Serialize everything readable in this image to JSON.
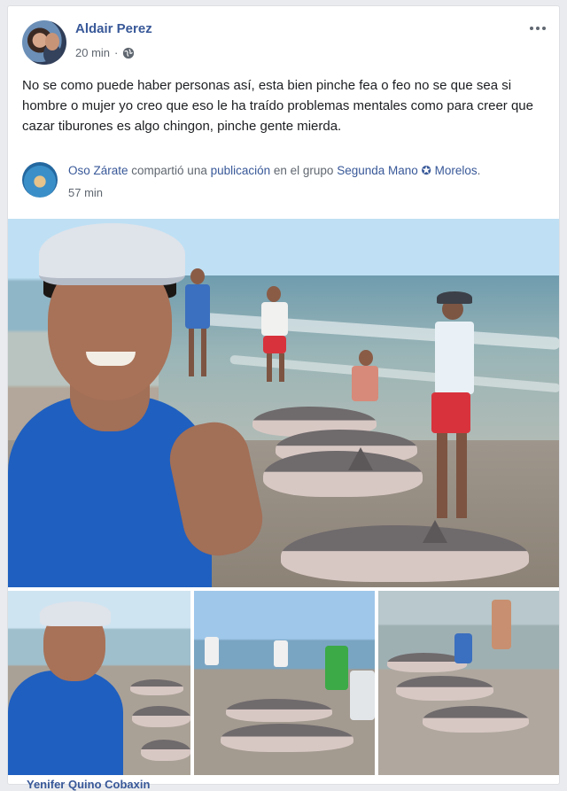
{
  "post": {
    "author": "Aldair Perez",
    "time": "20 min",
    "text": "No se como puede haber personas así, esta bien pinche fea o feo no se que sea si hombre o mujer yo creo que eso le ha traído problemas mentales como para creer que cazar tiburones es algo chingon, pinche gente mierda."
  },
  "shared": {
    "author": "Oso Zárate",
    "verb": " compartió una ",
    "object": "publicación",
    "group_prefix": " en el grupo ",
    "group": "Segunda Mano ✪ Morelos",
    "suffix": ".",
    "time": "57 min"
  },
  "next_comment_author": "Yenifer Quino Cobaxin",
  "icons": {
    "audience": "globe-icon",
    "menu": "more-options-icon"
  },
  "colors": {
    "link": "#385898",
    "meta": "#606770",
    "background": "#e9ebee"
  }
}
